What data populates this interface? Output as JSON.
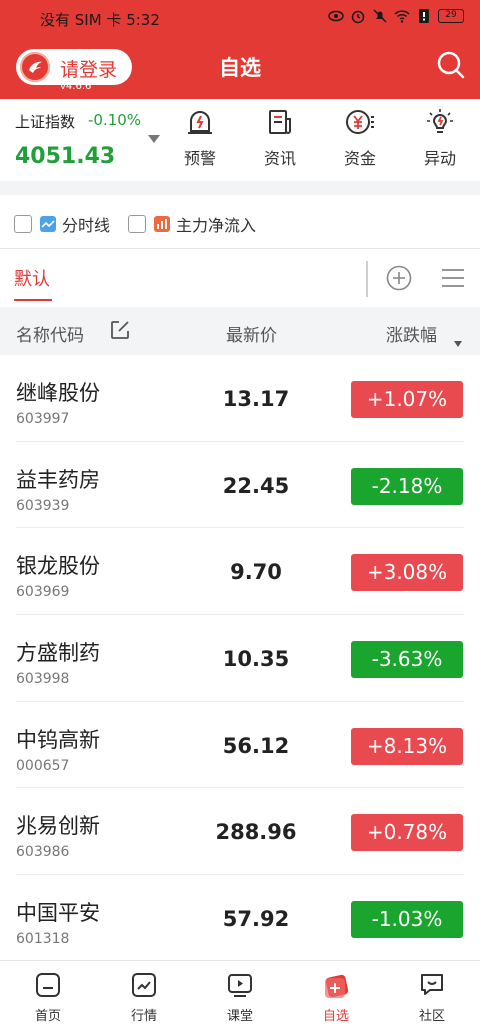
{
  "status_bar": {
    "text": "没有 SIM 卡 5:32",
    "battery": "29"
  },
  "header": {
    "login_label": "请登录",
    "version": "v4.6.6",
    "title": "自选"
  },
  "index": {
    "name": "上证指数",
    "change": "-0.10%",
    "value": "4051.43"
  },
  "tools": [
    {
      "label": "预警",
      "icon": "bell-alert-icon"
    },
    {
      "label": "资讯",
      "icon": "news-icon"
    },
    {
      "label": "资金",
      "icon": "money-icon"
    },
    {
      "label": "异动",
      "icon": "lightbulb-icon"
    }
  ],
  "options": [
    {
      "label": "分时线",
      "checked": false
    },
    {
      "label": "主力净流入",
      "checked": false
    }
  ],
  "tabs": {
    "default": "默认"
  },
  "columns": {
    "name": "名称代码",
    "price": "最新价",
    "change": "涨跌幅"
  },
  "stocks": [
    {
      "name": "继峰股份",
      "code": "603997",
      "price": "13.17",
      "change": "+1.07%",
      "direction": "up"
    },
    {
      "name": "益丰药房",
      "code": "603939",
      "price": "22.45",
      "change": "-2.18%",
      "direction": "down"
    },
    {
      "name": "银龙股份",
      "code": "603969",
      "price": "9.70",
      "change": "+3.08%",
      "direction": "up"
    },
    {
      "name": "方盛制药",
      "code": "603998",
      "price": "10.35",
      "change": "-3.63%",
      "direction": "down"
    },
    {
      "name": "中钨高新",
      "code": "000657",
      "price": "56.12",
      "change": "+8.13%",
      "direction": "up"
    },
    {
      "name": "兆易创新",
      "code": "603986",
      "price": "288.96",
      "change": "+0.78%",
      "direction": "up"
    },
    {
      "name": "中国平安",
      "code": "601318",
      "price": "57.92",
      "change": "-1.03%",
      "direction": "down"
    }
  ],
  "nav": [
    {
      "label": "首页",
      "icon": "home-icon"
    },
    {
      "label": "行情",
      "icon": "chart-icon"
    },
    {
      "label": "课堂",
      "icon": "video-icon"
    },
    {
      "label": "自选",
      "icon": "watchlist-icon",
      "active": true
    },
    {
      "label": "社区",
      "icon": "community-icon"
    }
  ],
  "colors": {
    "brand_red": "#e43a36",
    "up_red": "#e84a4f",
    "down_green": "#1aa52f"
  }
}
